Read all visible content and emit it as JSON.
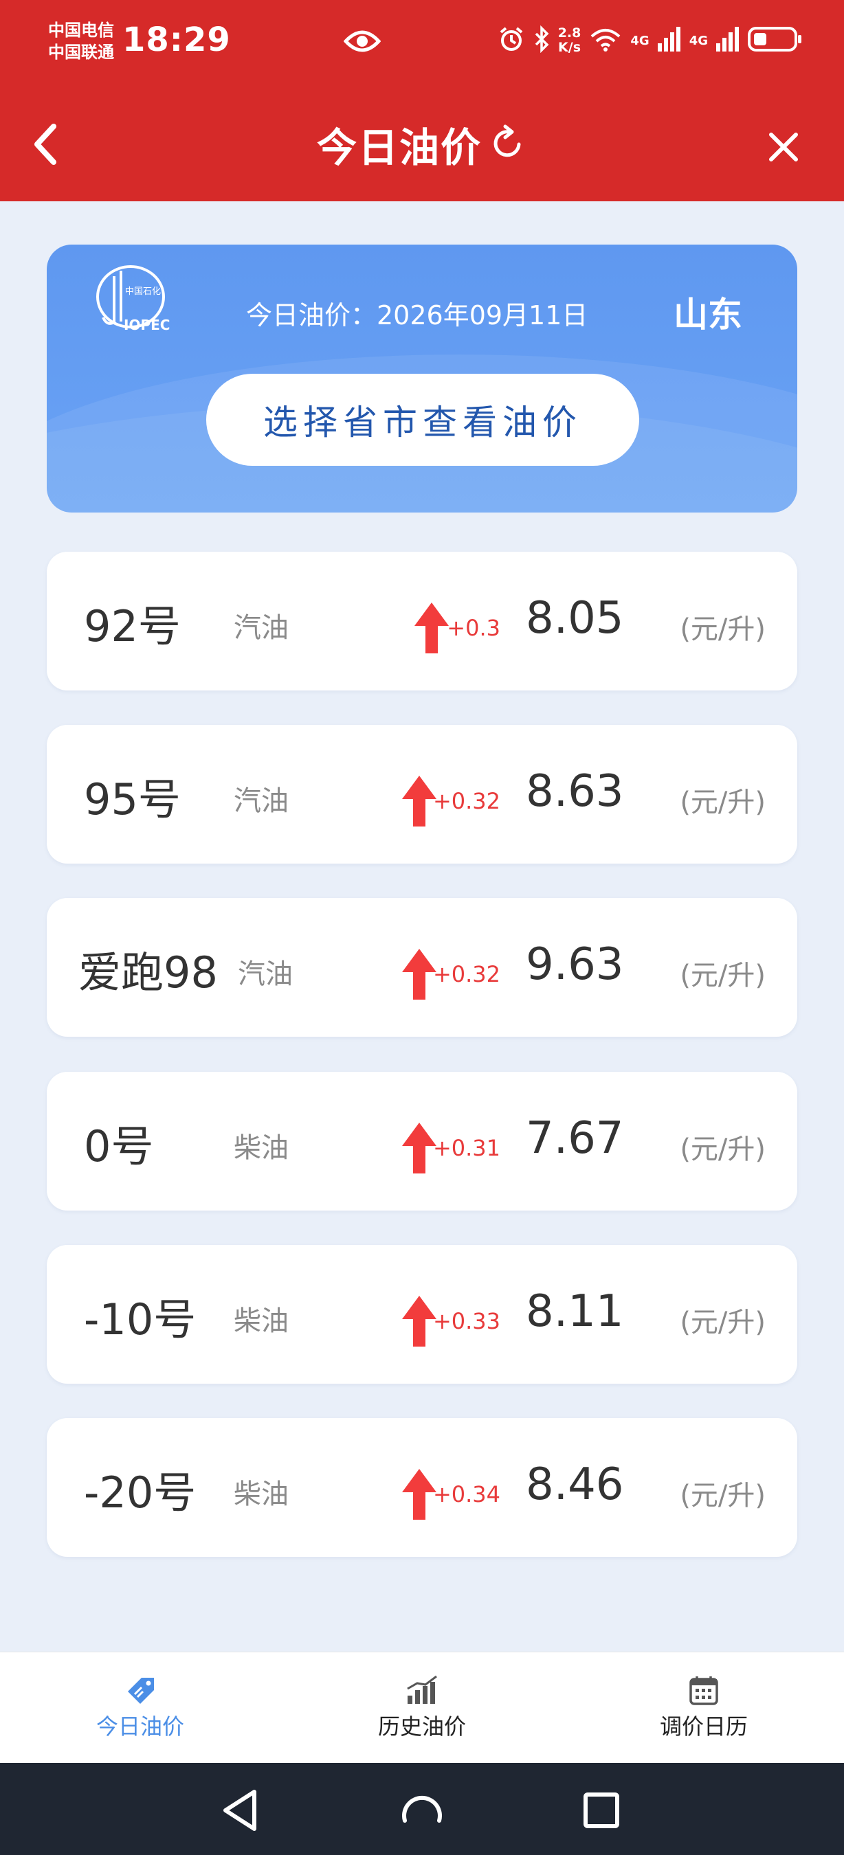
{
  "status_bar": {
    "carrier1": "中国电信",
    "carrier2": "中国联通",
    "time": "18:29",
    "speed_value": "2.8",
    "speed_unit": "K/s",
    "network1": "4G",
    "network2": "4G"
  },
  "header": {
    "title": "今日油价"
  },
  "banner": {
    "date_label": "今日油价：2026年09月11日",
    "province": "山东",
    "select_button": "选择省市查看油价"
  },
  "prices": [
    {
      "grade": "92号",
      "fuel": "汽油",
      "change": "+0.3",
      "price": "8.05",
      "unit": "(元/升)"
    },
    {
      "grade": "95号",
      "fuel": "汽油",
      "change": "+0.32",
      "price": "8.63",
      "unit": "(元/升)"
    },
    {
      "grade": "爱跑98",
      "fuel": "汽油",
      "change": "+0.32",
      "price": "9.63",
      "unit": "(元/升)"
    },
    {
      "grade": "0号",
      "fuel": "柴油",
      "change": "+0.31",
      "price": "7.67",
      "unit": "(元/升)"
    },
    {
      "grade": "-10号",
      "fuel": "柴油",
      "change": "+0.33",
      "price": "8.11",
      "unit": "(元/升)"
    },
    {
      "grade": "-20号",
      "fuel": "柴油",
      "change": "+0.34",
      "price": "8.46",
      "unit": "(元/升)"
    }
  ],
  "tabs": [
    {
      "label": "今日油价",
      "icon": "price-tag-icon",
      "active": true
    },
    {
      "label": "历史油价",
      "icon": "bar-chart-icon",
      "active": false
    },
    {
      "label": "调价日历",
      "icon": "calendar-icon",
      "active": false
    }
  ],
  "colors": {
    "header_red": "#d62a29",
    "banner_blue": "#6aa3f5",
    "rise_red": "#e83a3a",
    "active_tab_blue": "#4b8ee6"
  }
}
